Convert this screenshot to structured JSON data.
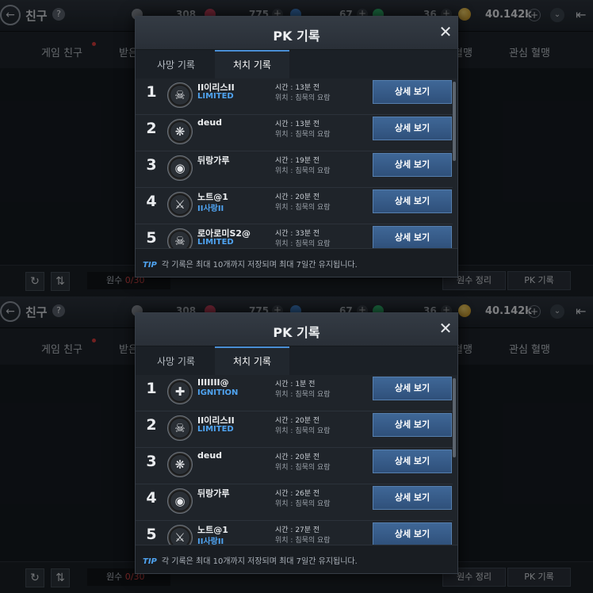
{
  "top": {
    "header": {
      "title": "친구",
      "help": "?",
      "back_icon": "back-arrow-icon"
    },
    "currencies": [
      "308",
      "775",
      "67",
      "36"
    ],
    "gold": "40.142k",
    "bg_tabs": [
      "게임 친구",
      "받은",
      "혈맹",
      "관심 혈맹"
    ],
    "bottom": {
      "slots_label": "원수",
      "slots_count": "0/30",
      "sort_btn": "원수 정리",
      "pk_btn": "PK 기록"
    },
    "modal": {
      "title": "PK 기록",
      "tabs": [
        "사망 기록",
        "처치 기록"
      ],
      "active_tab": 1,
      "rows": [
        {
          "rank": "1",
          "name": "II이리스II",
          "guild": "LIMITED",
          "time": "시간 : 13분 전",
          "loc": "위치 : 침묵의 요람",
          "btn": "상세 보기",
          "emblem": "skull-emblem-icon"
        },
        {
          "rank": "2",
          "name": "deud",
          "guild": "",
          "time": "시간 : 13분 전",
          "loc": "위치 : 침묵의 요람",
          "btn": "상세 보기",
          "emblem": "winged-emblem-icon"
        },
        {
          "rank": "3",
          "name": "뒤랑가루",
          "guild": "",
          "time": "시간 : 19분 전",
          "loc": "위치 : 침묵의 요람",
          "btn": "상세 보기",
          "emblem": "mask-emblem-icon"
        },
        {
          "rank": "4",
          "name": "노트@1",
          "guild": "II사랑II",
          "time": "시간 : 20분 전",
          "loc": "위치 : 침묵의 요람",
          "btn": "상세 보기",
          "emblem": "crossed-axes-emblem-icon"
        },
        {
          "rank": "5",
          "name": "로아로미S2@",
          "guild": "LIMITED",
          "time": "시간 : 33분 전",
          "loc": "위치 : 침묵의 요람",
          "btn": "상세 보기",
          "emblem": "skull-emblem-icon"
        }
      ],
      "tip_label": "TIP",
      "tip": "각 기록은 최대 10개까지 저장되며 최대 7일간 유지됩니다."
    }
  },
  "bottom": {
    "header": {
      "title": "친구",
      "help": "?",
      "back_icon": "back-arrow-icon"
    },
    "currencies": [
      "308",
      "775",
      "67",
      "36"
    ],
    "gold": "40.142k",
    "bg_tabs": [
      "게임 친구",
      "받은",
      "혈맹",
      "관심 혈맹"
    ],
    "bottom": {
      "slots_label": "원수",
      "slots_count": "0/30",
      "sort_btn": "원수 정리",
      "pk_btn": "PK 기록"
    },
    "modal": {
      "title": "PK 기록",
      "tabs": [
        "사망 기록",
        "처치 기록"
      ],
      "active_tab": 1,
      "rows": [
        {
          "rank": "1",
          "name": "IIIIIII@",
          "guild": "IGNITION",
          "time": "시간 : 1분 전",
          "loc": "위치 : 침묵의 요람",
          "btn": "상세 보기",
          "emblem": "slash-emblem-icon"
        },
        {
          "rank": "2",
          "name": "II이리스II",
          "guild": "LIMITED",
          "time": "시간 : 20분 전",
          "loc": "위치 : 침묵의 요람",
          "btn": "상세 보기",
          "emblem": "skull-emblem-icon"
        },
        {
          "rank": "3",
          "name": "deud",
          "guild": "",
          "time": "시간 : 20분 전",
          "loc": "위치 : 침묵의 요람",
          "btn": "상세 보기",
          "emblem": "winged-emblem-icon"
        },
        {
          "rank": "4",
          "name": "뒤랑가루",
          "guild": "",
          "time": "시간 : 26분 전",
          "loc": "위치 : 침묵의 요람",
          "btn": "상세 보기",
          "emblem": "mask-emblem-icon"
        },
        {
          "rank": "5",
          "name": "노트@1",
          "guild": "II사랑II",
          "time": "시간 : 27분 전",
          "loc": "위치 : 침묵의 요람",
          "btn": "상세 보기",
          "emblem": "crossed-axes-emblem-icon"
        }
      ],
      "tip_label": "TIP",
      "tip": "각 기록은 최대 10개까지 저장되며 최대 7일간 유지됩니다."
    }
  },
  "colors": {
    "accent_blue": "#4fa3f0",
    "button_blue": "#3f6797",
    "red_dot": "#d23b3b",
    "gold": "#e0b23a"
  }
}
